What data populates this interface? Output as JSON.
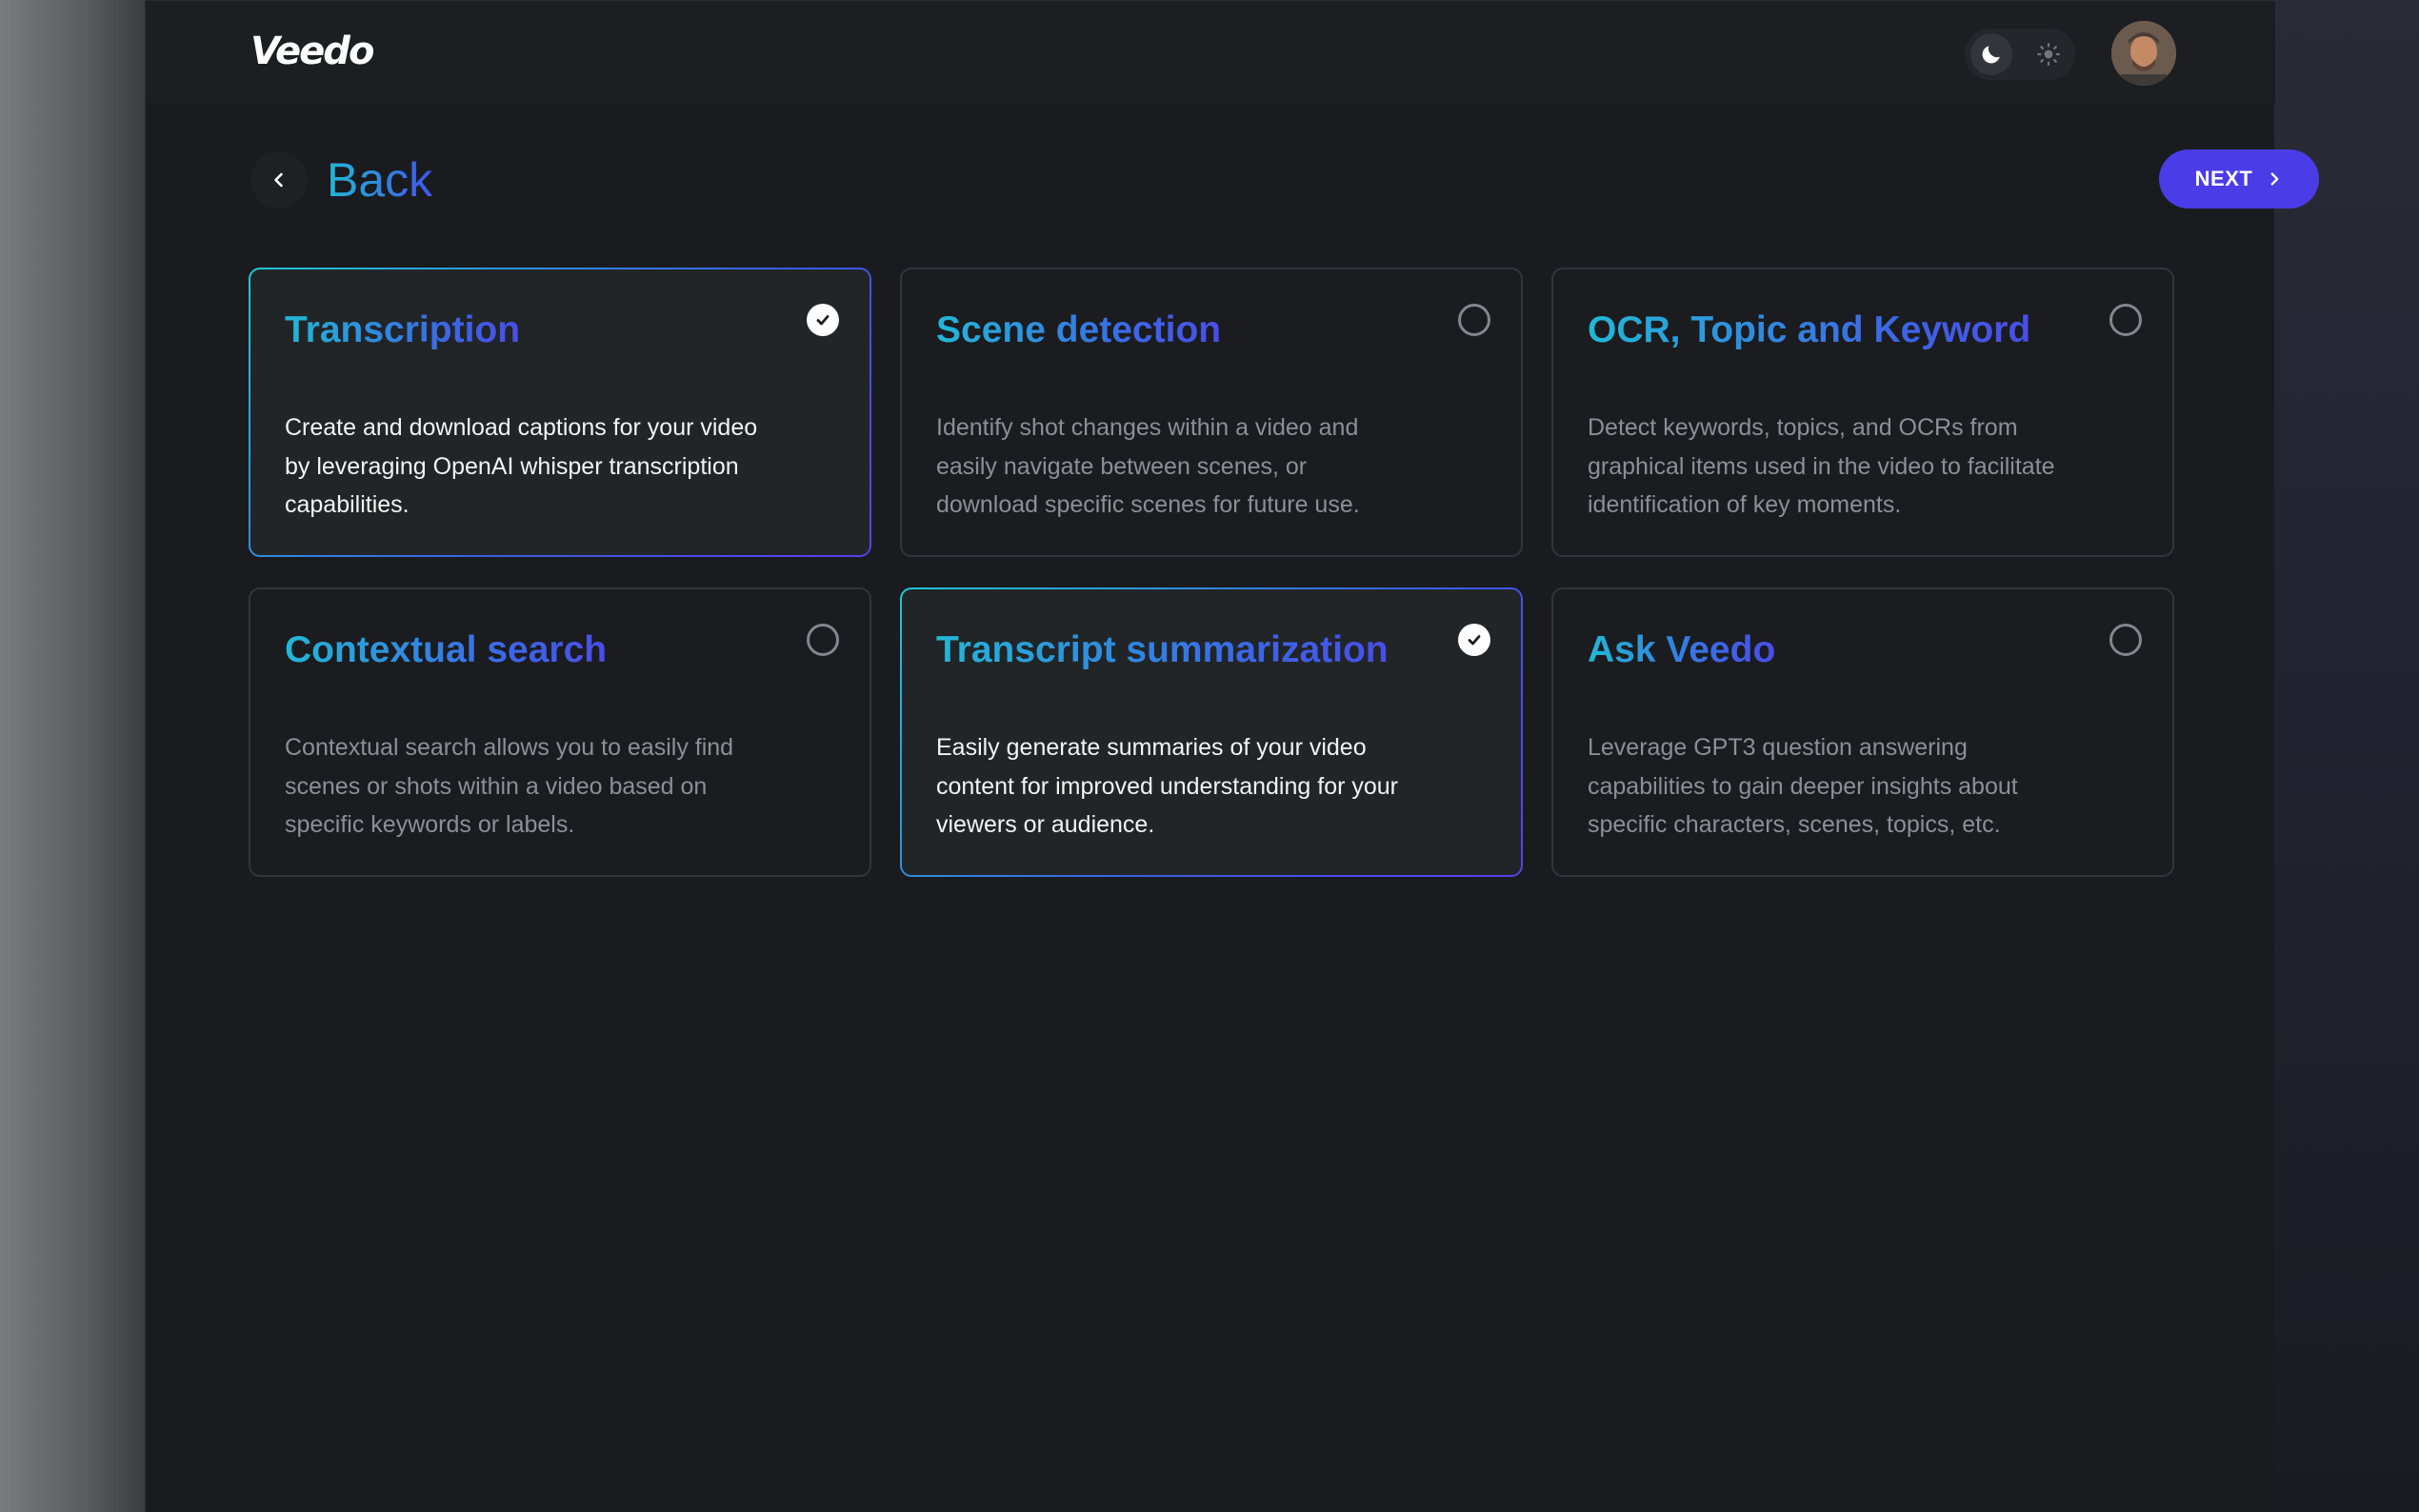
{
  "app": {
    "logo": "Veedo"
  },
  "header": {
    "theme_toggle": {
      "active": "dark",
      "icons": [
        "moon-icon",
        "sun-icon"
      ]
    },
    "avatar_icon": "user-avatar"
  },
  "nav": {
    "back_label": "Back",
    "next_label": "NEXT"
  },
  "colors": {
    "background": "#1a1b1f",
    "accent": "#4a3de8",
    "gradient_start": "#22b8d6",
    "gradient_end": "#4a4de8"
  },
  "cards": [
    {
      "title": "Transcription",
      "description": "Create and download captions for your video by leveraging OpenAI whisper transcription capabilities.",
      "selected": true
    },
    {
      "title": "Scene detection",
      "description": "Identify shot changes within a video and easily navigate between scenes, or download specific scenes for future use.",
      "selected": false
    },
    {
      "title": "OCR, Topic and Keyword",
      "description": "Detect keywords, topics, and OCRs from graphical items used in the video to facilitate identification of key moments.",
      "selected": false
    },
    {
      "title": "Contextual search",
      "description": "Contextual search allows you to easily find scenes or shots within a video based on specific keywords or labels.",
      "selected": false
    },
    {
      "title": "Transcript summarization",
      "description": "Easily generate summaries of your video content for improved understanding for your viewers or audience.",
      "selected": true
    },
    {
      "title": "Ask Veedo",
      "description": "Leverage GPT3 question answering capabilities to gain deeper insights about specific characters, scenes, topics, etc.",
      "selected": false
    }
  ]
}
